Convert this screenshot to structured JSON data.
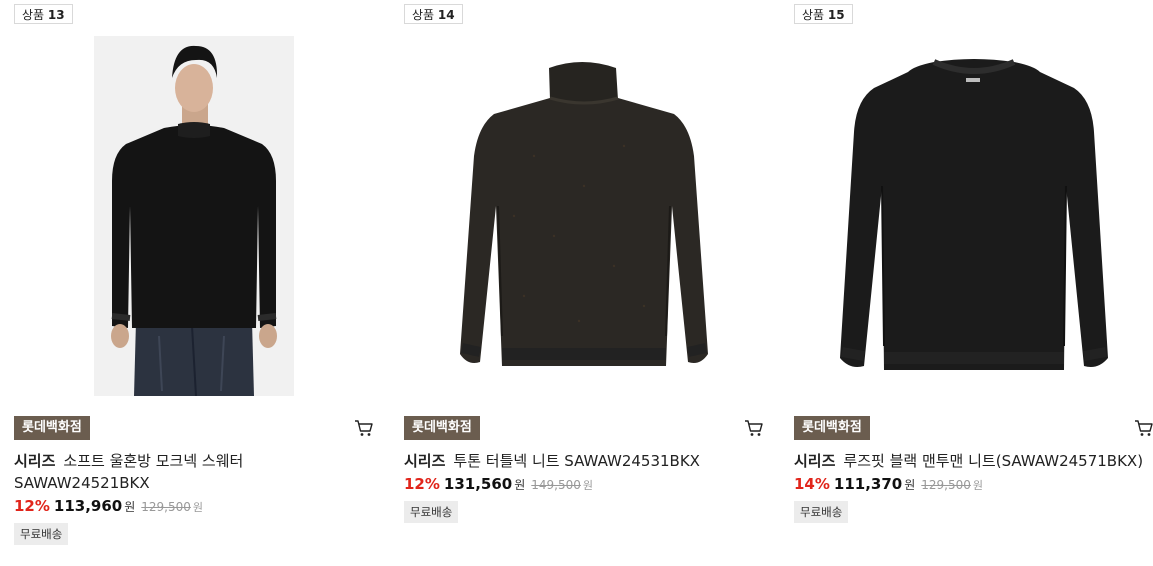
{
  "products": [
    {
      "badge_prefix": "상품",
      "badge_number": "13",
      "brand": "롯데백화점",
      "series": "시리즈",
      "name": "소프트 울혼방 모크넥 스웨터 SAWAW24521BKX",
      "discount": "12%",
      "sale_price": "113,960",
      "currency": "원",
      "original_price": "129,500",
      "shipping": "무료배송",
      "image": "model-mockneck-sweater"
    },
    {
      "badge_prefix": "상품",
      "badge_number": "14",
      "brand": "롯데백화점",
      "series": "시리즈",
      "name": "투톤 터틀넥 니트 SAWAW24531BKX",
      "discount": "12%",
      "sale_price": "131,560",
      "currency": "원",
      "original_price": "149,500",
      "shipping": "무료배송",
      "image": "turtleneck-knit"
    },
    {
      "badge_prefix": "상품",
      "badge_number": "15",
      "brand": "롯데백화점",
      "series": "시리즈",
      "name": "루즈핏 블랙 맨투맨 니트(SAWAW24571BKX)",
      "discount": "14%",
      "sale_price": "111,370",
      "currency": "원",
      "original_price": "129,500",
      "shipping": "무료배송",
      "image": "crewneck-knit"
    }
  ],
  "colors": {
    "brand_badge_bg": "#6b5d4f",
    "discount_red": "#e1251b",
    "shipping_bg": "#ececec"
  },
  "icons": [
    "cart-icon"
  ]
}
